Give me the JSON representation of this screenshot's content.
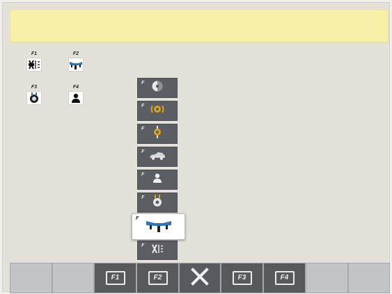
{
  "message": "",
  "shortcuts": [
    {
      "key": "F1",
      "icon": "lift-frame-icon"
    },
    {
      "key": "F2",
      "icon": "alignment-head-icon"
    },
    {
      "key": "F3",
      "icon": "wheel-clamp-icon"
    },
    {
      "key": "F4",
      "icon": "customer-icon"
    }
  ],
  "menu": {
    "prefix": "F",
    "items": [
      {
        "icon": "wheel-icon",
        "selected": false
      },
      {
        "icon": "runout-icon",
        "selected": false
      },
      {
        "icon": "steering-angle-icon",
        "selected": false
      },
      {
        "icon": "vehicle-icon",
        "selected": false
      },
      {
        "icon": "customer-icon",
        "selected": false
      },
      {
        "icon": "wheel-clamp-icon",
        "selected": false
      },
      {
        "icon": "alignment-head-icon",
        "selected": true
      },
      {
        "icon": "lift-frame-icon",
        "selected": false
      }
    ]
  },
  "bottom_bar": {
    "keys": [
      "F1",
      "F2",
      "F3",
      "F4"
    ],
    "close_icon": "close-icon"
  },
  "colors": {
    "screen_bg": "#e3e1da",
    "message_bg": "#f7f0a8",
    "menu_bg": "#5a5d62",
    "bar_empty": "#c2c4c7",
    "bar_key": "#57595d"
  }
}
